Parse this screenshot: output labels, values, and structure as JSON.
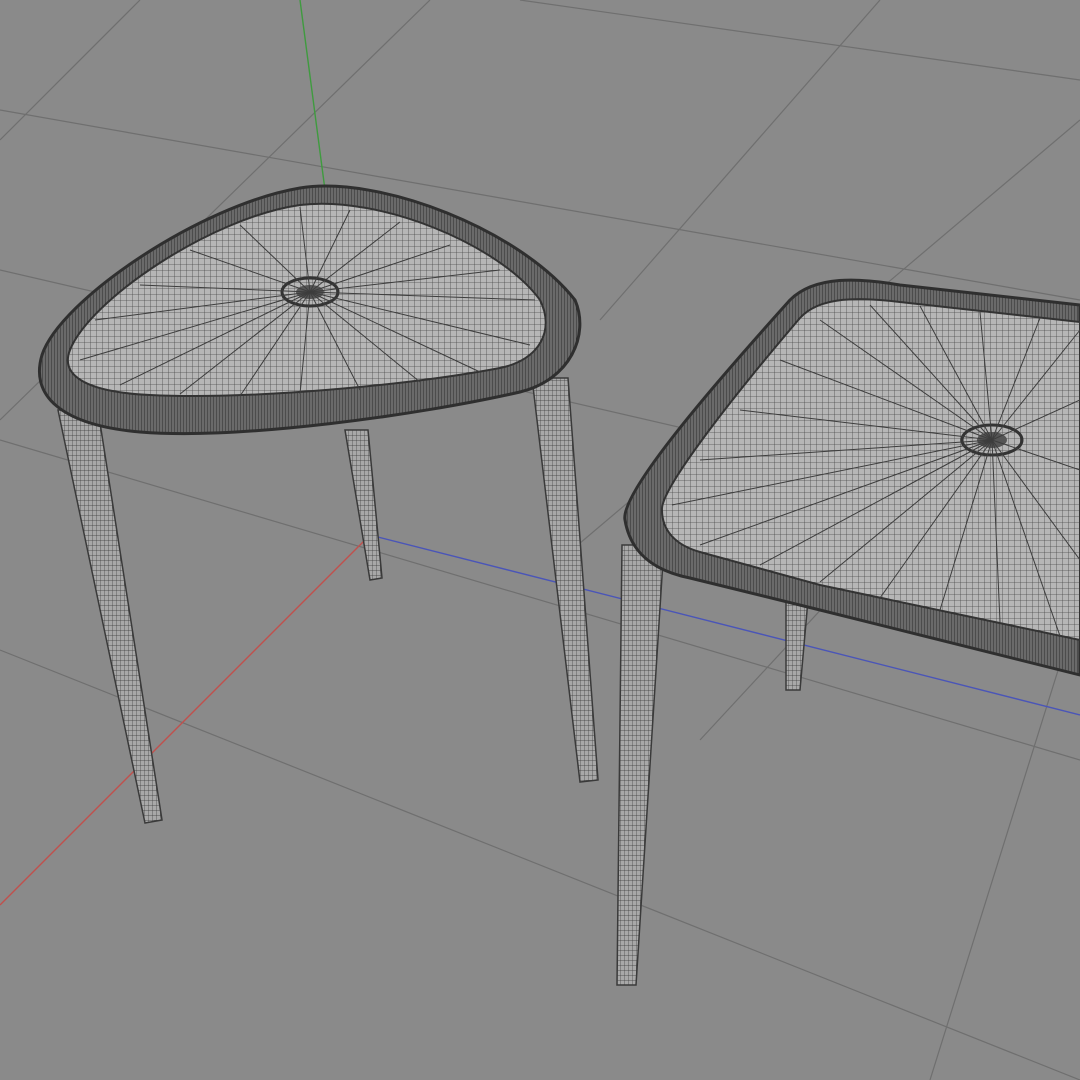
{
  "viewport": {
    "kind": "3d-viewport-wireframe",
    "background_color": "#8a8a8a",
    "grid_color": "#6f6f6f",
    "axis_colors": {
      "x": "#c0504d",
      "y": "#3f9b3f",
      "z": "#4a55b8"
    },
    "wire_color": "#3c3c3c",
    "fill_color": "#b6b6b6"
  },
  "scene": {
    "objects": [
      {
        "name": "triangular-side-table",
        "shape": "rounded-triangle-top",
        "legs": 3
      },
      {
        "name": "square-side-table",
        "shape": "rounded-square-top",
        "legs": 4
      }
    ]
  }
}
